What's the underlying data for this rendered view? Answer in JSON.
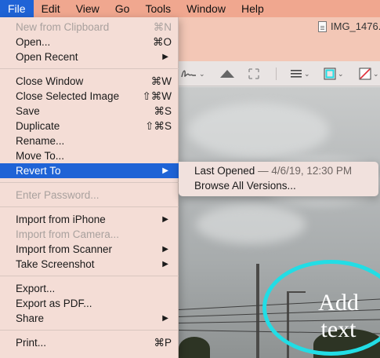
{
  "menubar": {
    "items": [
      "File",
      "Edit",
      "View",
      "Go",
      "Tools",
      "Window",
      "Help"
    ]
  },
  "window": {
    "title": "IMG_1476."
  },
  "file_menu": {
    "new_from_clipboard": {
      "label": "New from Clipboard",
      "shortcut": "⌘N"
    },
    "open": {
      "label": "Open...",
      "shortcut": "⌘O"
    },
    "open_recent": {
      "label": "Open Recent"
    },
    "close_window": {
      "label": "Close Window",
      "shortcut": "⌘W"
    },
    "close_selected_image": {
      "label": "Close Selected Image",
      "shortcut": "⇧⌘W"
    },
    "save": {
      "label": "Save",
      "shortcut": "⌘S"
    },
    "duplicate": {
      "label": "Duplicate",
      "shortcut": "⇧⌘S"
    },
    "rename": {
      "label": "Rename..."
    },
    "move_to": {
      "label": "Move To..."
    },
    "revert_to": {
      "label": "Revert To"
    },
    "enter_password": {
      "label": "Enter Password..."
    },
    "import_from_iphone": {
      "label": "Import from iPhone"
    },
    "import_from_camera": {
      "label": "Import from Camera..."
    },
    "import_from_scanner": {
      "label": "Import from Scanner"
    },
    "take_screenshot": {
      "label": "Take Screenshot"
    },
    "export": {
      "label": "Export..."
    },
    "export_as_pdf": {
      "label": "Export as PDF..."
    },
    "share": {
      "label": "Share"
    },
    "print": {
      "label": "Print...",
      "shortcut": "⌘P"
    }
  },
  "revert_submenu": {
    "last_opened_label": "Last Opened",
    "last_opened_date": "— 4/6/19, 12:30 PM",
    "browse_all_versions": "Browse All Versions..."
  },
  "annotation": {
    "text_line1": "Add",
    "text_line2": "text"
  },
  "colors": {
    "menubar_bg": "#f0a78f",
    "highlight": "#1f63d6",
    "annotation_ellipse": "#22dde5",
    "border_color_swatch": "#22dde5",
    "fill_color_swatch": "#e0303a"
  },
  "icons": [
    "signature-icon",
    "adjust-color-icon",
    "crop-icon",
    "shape-style-icon",
    "border-color-icon",
    "fill-color-icon",
    "document-icon",
    "submenu-arrow-icon"
  ]
}
